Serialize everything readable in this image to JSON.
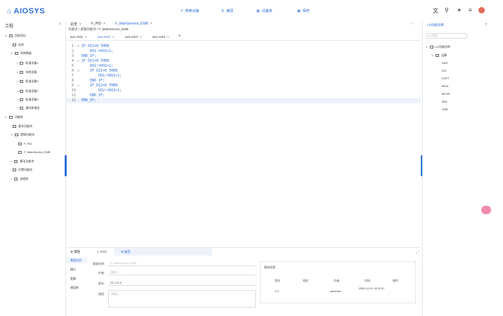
{
  "header": {
    "logo_icon": "⌂",
    "logo_text": "AIOSYS",
    "nav": [
      {
        "icon": "search-icon",
        "glyph": "⚲",
        "label": "搜索设备"
      },
      {
        "icon": "compile-icon",
        "glyph": "⇅",
        "label": "编译"
      },
      {
        "icon": "device-icon",
        "glyph": "▦",
        "label": "设备库"
      },
      {
        "icon": "save-icon",
        "glyph": "▣",
        "label": "保存"
      }
    ],
    "tool_icons": [
      "文",
      "⚲",
      "☀",
      "≡"
    ]
  },
  "sidebar": {
    "title": "工程",
    "pin": "⇱",
    "tree": [
      {
        "arrow": "∨",
        "label": "西贵西仪",
        "level": 0
      },
      {
        "arrow": "",
        "label": "总库",
        "level": 1
      },
      {
        "arrow": "∨",
        "label": "系统数据",
        "level": 1
      },
      {
        "arrow": ">",
        "label": "轨道设备1",
        "level": 2
      },
      {
        "arrow": ">",
        "label": "系统设备",
        "level": 2
      },
      {
        "arrow": ">",
        "label": "轨道设备3",
        "level": 2
      },
      {
        "arrow": ">",
        "label": "轨道设备2",
        "level": 2
      },
      {
        "arrow": ">",
        "label": "轨道设备3",
        "level": 2
      },
      {
        "arrow": ">",
        "label": "通讯和通信",
        "level": 2
      },
      {
        "arrow": "∨",
        "label": "功能库",
        "level": 0
      },
      {
        "arrow": "",
        "label": "基本功能块",
        "level": 1
      },
      {
        "arrow": "∨",
        "label": "逻辑功能块",
        "level": 1
      },
      {
        "arrow": "",
        "label": "F_PID",
        "level": 2
      },
      {
        "arrow": "",
        "label": "F_MainService_EMB",
        "level": 2
      },
      {
        "arrow": ">",
        "label": "算法功能块",
        "level": 1
      },
      {
        "arrow": "",
        "label": "位置功能块",
        "level": 1
      },
      {
        "arrow": ">",
        "label": "流程库",
        "level": 1
      }
    ]
  },
  "doc_tabs": [
    {
      "label": "总览",
      "active": false
    },
    {
      "label": "F_PID",
      "active": false
    },
    {
      "label": "F_MainService_EMB",
      "active": true
    }
  ],
  "doc_tab_corner": "‹ ›",
  "breadcrumb": [
    "功能块",
    "逻辑功能块",
    "F_MainService_EMB"
  ],
  "axis_tabs": [
    {
      "label": "axs.AIS1",
      "active": false
    },
    {
      "label": "axs.AIS2",
      "active": true
    },
    {
      "label": "axs.AIS3",
      "active": false
    },
    {
      "label": "axs.AIS4",
      "active": false
    }
  ],
  "code": {
    "current_line": 12,
    "lines": [
      {
        "n": "1",
        "fold": "∨",
        "text": "IF DI1=0 THEN"
      },
      {
        "n": "2",
        "fold": "",
        "text": "    DO1:=DO1+1;"
      },
      {
        "n": "3",
        "fold": "",
        "text": "END_IF;"
      },
      {
        "n": "4",
        "fold": "∨",
        "text": "IF DI1=0 THEN"
      },
      {
        "n": "5",
        "fold": "",
        "text": "    DO2:=DO2+1;"
      },
      {
        "n": "6",
        "fold": "∨",
        "text": "    IF DI1=0 THEN"
      },
      {
        "n": "7",
        "fold": "",
        "text": "        DO1:=DO1+1;"
      },
      {
        "n": "8",
        "fold": "",
        "text": "    END_IF;"
      },
      {
        "n": "9",
        "fold": "∨",
        "text": "    IF DI2=0 THEN"
      },
      {
        "n": "10",
        "fold": "",
        "text": "        DO2:=DO2+1;"
      },
      {
        "n": "11",
        "fold": "",
        "text": "    END_IF;"
      },
      {
        "n": "12",
        "fold": "",
        "text": "END_IF;"
      }
    ]
  },
  "bottom": {
    "tabs": [
      {
        "icon": "⚙",
        "label": "属性"
      },
      {
        "icon": "◇",
        "label": "FCC"
      },
      {
        "icon": "⊞",
        "label": "报告"
      }
    ],
    "active_tab": 2,
    "corner": "⤢",
    "side_items": [
      "基础信息",
      "接口",
      "变量",
      "调用库"
    ],
    "active_side": 0,
    "form": {
      "name_label": "基础名称:",
      "name_value": "F_MainService_EMB",
      "author_label": "作者:",
      "author_placeholder": "请输入",
      "version_label": "版本:",
      "version_value": "V1.171.2",
      "desc_label": "描述:",
      "desc_placeholder": "请输入"
    },
    "versions": {
      "title": "版本信息",
      "headers": [
        "版本",
        "描述",
        "作者",
        "时间",
        "操作"
      ],
      "rows": [
        {
          "version": "1.0",
          "desc": "",
          "author": "yanzhao",
          "time": "2024-12-11 14:21:57",
          "op": ""
        }
      ]
    }
  },
  "right_panel": {
    "tab": "LD功能块库",
    "chevron": "›",
    "search_placeholder": "Q 搜索",
    "tree": [
      {
        "label": "LD功能块库",
        "level": 0,
        "arrow": "∨"
      },
      {
        "label": "运算",
        "level": 1,
        "arrow": "∨"
      },
      {
        "label": "ADD",
        "level": 2,
        "arrow": ""
      },
      {
        "label": "DIV",
        "level": 2,
        "arrow": ""
      },
      {
        "label": "EXPT",
        "level": 2,
        "arrow": ""
      },
      {
        "label": "MOD",
        "level": 2,
        "arrow": ""
      },
      {
        "label": "MOVE",
        "level": 2,
        "arrow": ""
      },
      {
        "label": "MUL",
        "level": 2,
        "arrow": ""
      },
      {
        "label": "SUB",
        "level": 2,
        "arrow": ""
      }
    ]
  },
  "colors": {
    "accent": "#2f6fd6",
    "selected_bg": "#eef3fb",
    "fab": "#f28bb0",
    "avatar": "#e36b5a"
  }
}
